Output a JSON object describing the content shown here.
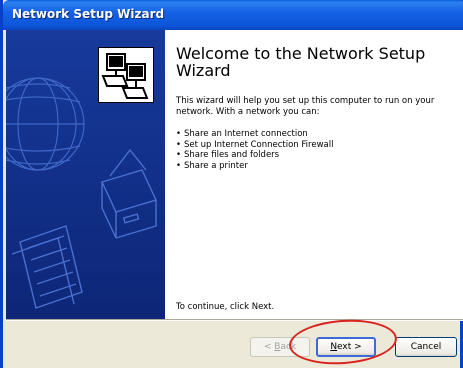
{
  "window": {
    "title": "Network Setup Wizard"
  },
  "content": {
    "heading": "Welcome to the Network Setup Wizard",
    "intro": "This wizard will help you set up this computer to run on your network. With a network you can:",
    "bullets": [
      "Share an Internet connection",
      "Set up Internet Connection Firewall",
      "Share files and folders",
      "Share a printer"
    ],
    "continue_text": "To continue, click Next."
  },
  "buttons": {
    "back_label_prefix": "< ",
    "back_label_mnemonic": "B",
    "back_label_rest": "ack",
    "next_label_mnemonic": "N",
    "next_label_rest": "ext >",
    "cancel_label": "Cancel"
  },
  "colors": {
    "titlebar": "#0a5fdc",
    "sidebar": "#112f8c",
    "annotation": "#d8231e"
  },
  "icons": {
    "header": "network-computers-icon",
    "sidebar": [
      "globe-icon",
      "printer-icon",
      "documents-icon"
    ]
  }
}
